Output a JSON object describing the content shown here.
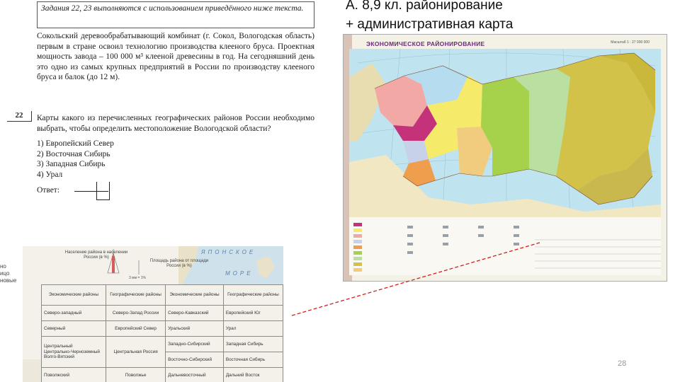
{
  "exam": {
    "intro": "Задания 22, 23 выполняются с использованием приведённого ниже текста.",
    "paragraph": "Сокольский деревообрабатывающий комбинат (г. Сокол, Вологодская область) первым в стране освоил технологию производства клееного бруса. Проектная мощность завода – 100 000 м³ клееной древесины в год. На сегодняшний день это одно из самых крупных предприятий в России по производству клееного бруса и балок (до 12 м).",
    "question_number": "22",
    "question": "Карты какого из перечисленных географических районов России необходимо выбрать, чтобы определить местоположение Вологодской области?",
    "options": [
      "1)  Европейский Север",
      "2)  Восточная Сибирь",
      "3)  Западная Сибирь",
      "4)  Урал"
    ],
    "answer_label": "Ответ:"
  },
  "heading": {
    "line1": "А. 8,9 кл. районирование",
    "line2": "+ административная карта"
  },
  "map": {
    "title": "ЭКОНОМИЧЕСКОЕ РАЙОНИРОВАНИЕ",
    "scale": "Масштаб 1 : 27 000 000"
  },
  "scan": {
    "side_text": [
      "но",
      "ицо",
      "новые"
    ],
    "population_label": "Население района в населении России (в %)",
    "area_label": "Площадь района от площади России (в %)",
    "one_pct": "3 мм = 1%",
    "sea_word1": "ЯПОНСКОЕ",
    "sea_word2": "МОРЕ",
    "table_headers": [
      "Экономические районы",
      "Географические районы",
      "Экономические районы",
      "Географические районы"
    ],
    "table_rows": [
      [
        "Северо-западный",
        "Северо-Запад России",
        "Северо-Кавказский",
        "Европейский Юг"
      ],
      [
        "Северный",
        "Европейский Север",
        "Уральский",
        "Урал"
      ],
      [
        "Центральный\nЦентрально-Черноземный\nВолго-Вятский",
        "Центральная Россия",
        "Западно-Сибирский",
        "Западная Сибирь"
      ],
      [
        "",
        "",
        "Восточно-Сибирский",
        "Восточная Сибирь"
      ],
      [
        "Поволжский",
        "Поволжье",
        "Дальневосточный",
        "Дальний Восток"
      ]
    ]
  },
  "page_number": "28",
  "colors": {
    "connector": "#d21f1f",
    "map_title": "#6b2b7a"
  }
}
